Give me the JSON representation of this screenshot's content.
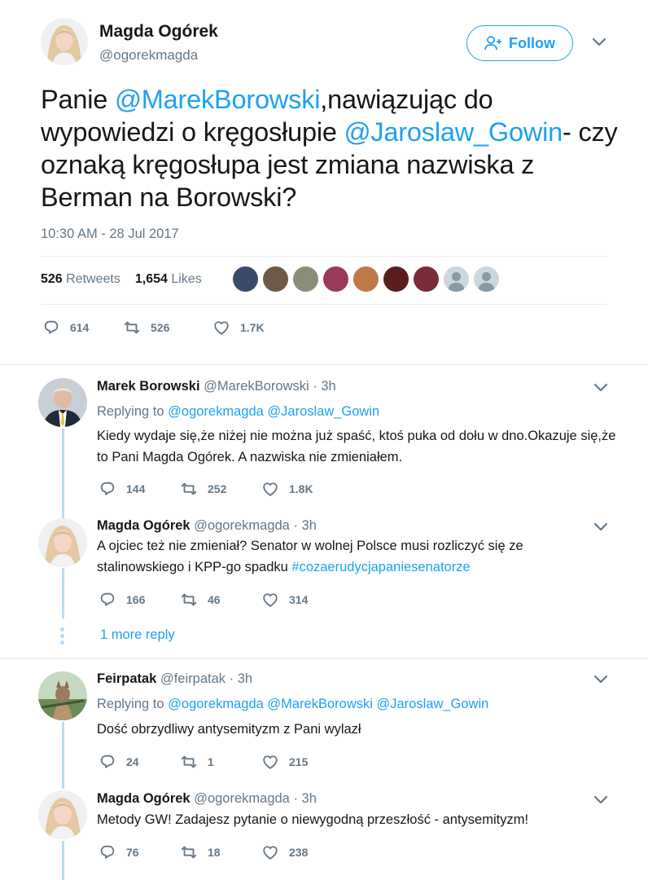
{
  "main_tweet": {
    "name": "Magda Ogórek",
    "handle": "@ogorekmagda",
    "follow_label": "Follow",
    "text": {
      "p1": "Panie ",
      "mention1": "@MarekBorowski",
      "p2": ",nawiązując do wypowiedzi o kręgosłupie ",
      "mention2": "@Jaroslaw_Gowin",
      "p3": "- czy oznaką kręgosłupa jest zmiana nazwiska z Berman na Borowski?"
    },
    "timestamp": "10:30 AM - 28 Jul 2017",
    "retweets_count": "526",
    "retweets_label": "Retweets",
    "likes_count": "1,654",
    "likes_label": "Likes",
    "actions": {
      "replies": "614",
      "retweets": "526",
      "likes": "1.7K"
    }
  },
  "replies": [
    {
      "name": "Marek Borowski",
      "handle": "@MarekBorowski",
      "time": "· 3h",
      "replying_label": "Replying to",
      "replying_to": "@ogorekmagda @Jaroslaw_Gowin",
      "text": "Kiedy wydaje się,że niżej nie można już spaść, ktoś puka od dołu w dno.Okazuje się,że to Pani Magda Ogórek. A nazwiska nie zmieniałem.",
      "actions": {
        "replies": "144",
        "retweets": "252",
        "likes": "1.8K"
      }
    },
    {
      "name": "Magda Ogórek",
      "handle": "@ogorekmagda",
      "time": "· 3h",
      "text_line1": "A ojciec też nie zmieniał? Senator w wolnej Polsce musi rozliczyć się ze",
      "text_line2_plain": "stalinowskiego i KPP-go spadku ",
      "hashtag": "#cozaerudycjapaniesenatorze",
      "actions": {
        "replies": "166",
        "retweets": "46",
        "likes": "314"
      }
    },
    {
      "name": "Feirpatak",
      "handle": "@feirpatak",
      "time": "· 3h",
      "replying_label": "Replying to",
      "replying_to": "@ogorekmagda @MarekBorowski @Jaroslaw_Gowin",
      "text": "Dość obrzydliwy antysemityzm z Pani wylazł",
      "actions": {
        "replies": "24",
        "retweets": "1",
        "likes": "215"
      }
    },
    {
      "name": "Magda Ogórek",
      "handle": "@ogorekmagda",
      "time": "· 3h",
      "text": "Metody GW! Zadajesz pytanie o niewygodną przeszłość - antysemityzm!",
      "actions": {
        "replies": "76",
        "retweets": "18",
        "likes": "238"
      }
    }
  ],
  "more_reply_label": "1 more reply",
  "colors": {
    "accent": "#1da1f2",
    "muted": "#657786",
    "thread_line": "#b8dcf5"
  }
}
